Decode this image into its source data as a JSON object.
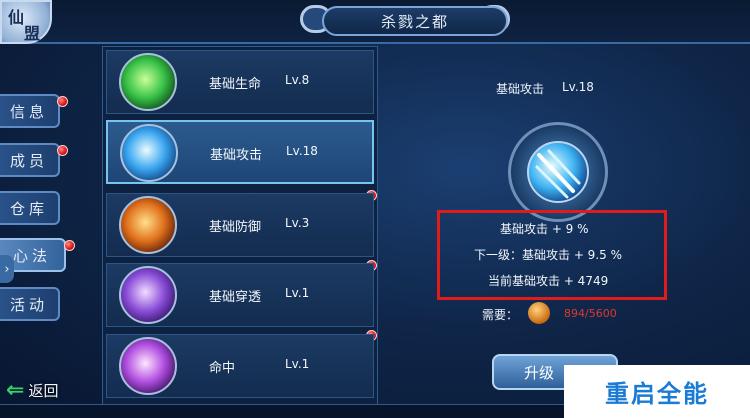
{
  "header": {
    "title": "杀戮之都",
    "logo_text": [
      "仙",
      "盟"
    ]
  },
  "sidebar": {
    "items": [
      {
        "label": "信息",
        "has_dot": true
      },
      {
        "label": "成员",
        "has_dot": true
      },
      {
        "label": "仓库",
        "has_dot": false
      },
      {
        "label": "心法",
        "has_dot": true,
        "active": true
      },
      {
        "label": "活动",
        "has_dot": false
      }
    ],
    "expand_arrow": "›",
    "back_label": "返回"
  },
  "skills": [
    {
      "name": "基础生命",
      "level": "Lv.8",
      "icon": "green-energy-icon",
      "color": "#38c247",
      "selected": false,
      "has_dot": false
    },
    {
      "name": "基础攻击",
      "level": "Lv.18",
      "icon": "blue-claw-icon",
      "color": "#3aa6f0",
      "selected": true,
      "has_dot": true
    },
    {
      "name": "基础防御",
      "level": "Lv.3",
      "icon": "fire-shield-icon",
      "color": "#e0701c",
      "selected": false,
      "has_dot": true
    },
    {
      "name": "基础穿透",
      "level": "Lv.1",
      "icon": "purple-claw-icon",
      "color": "#8a4ed8",
      "selected": false,
      "has_dot": true
    },
    {
      "name": "命中",
      "level": "Lv.1",
      "icon": "purple-orb-icon",
      "color": "#b04ee0",
      "selected": false,
      "has_dot": false
    }
  ],
  "detail": {
    "name": "基础攻击",
    "level": "Lv.18",
    "current_effect": "基础攻击 + 9 %",
    "next_effect": "下一级：基础攻击 + 9.5  %",
    "current_total": "当前基础攻击 + 4749",
    "need_label": "需要：",
    "need_value": "894/5600",
    "upgrade_label": "升级"
  },
  "watermark": "重启全能",
  "colors": {
    "highlight_box": "#e01b1b",
    "need_value": "#e0382d",
    "accent": "#79c4ee"
  }
}
